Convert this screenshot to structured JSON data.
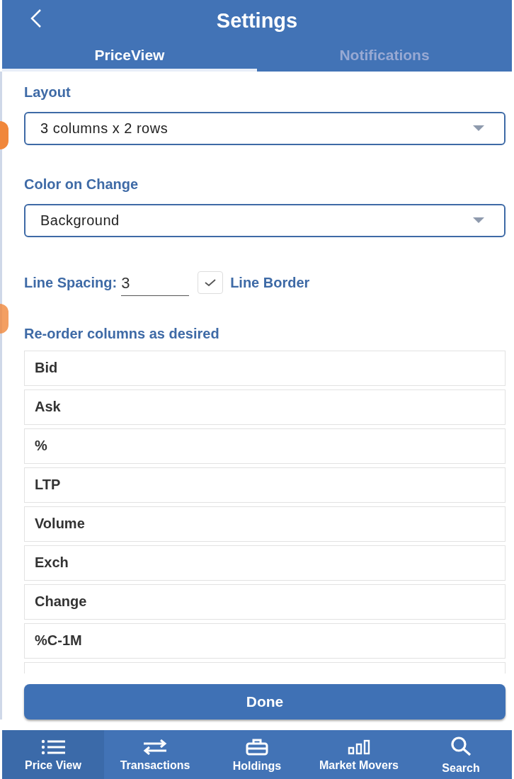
{
  "header": {
    "title": "Settings"
  },
  "tabs": [
    {
      "label": "PriceView",
      "selected": true
    },
    {
      "label": "Notifications",
      "selected": false
    }
  ],
  "layout": {
    "label": "Layout",
    "value": "3 columns x 2 rows"
  },
  "color_on_change": {
    "label": "Color on Change",
    "value": "Background"
  },
  "line_spacing": {
    "label": "Line Spacing:",
    "value": "3"
  },
  "line_border": {
    "label": "Line Border",
    "checked": true
  },
  "reorder": {
    "label": "Re-order columns as desired",
    "columns": [
      "Bid",
      "Ask",
      "%",
      "LTP",
      "Volume",
      "Exch",
      "Change",
      "%C-1M"
    ]
  },
  "done_button": "Done",
  "bottom_nav": [
    {
      "label": "Price View",
      "selected": true
    },
    {
      "label": "Transactions",
      "selected": false
    },
    {
      "label": "Holdings",
      "selected": false
    },
    {
      "label": "Market Movers",
      "selected": false
    },
    {
      "label": "Search",
      "selected": false
    }
  ]
}
